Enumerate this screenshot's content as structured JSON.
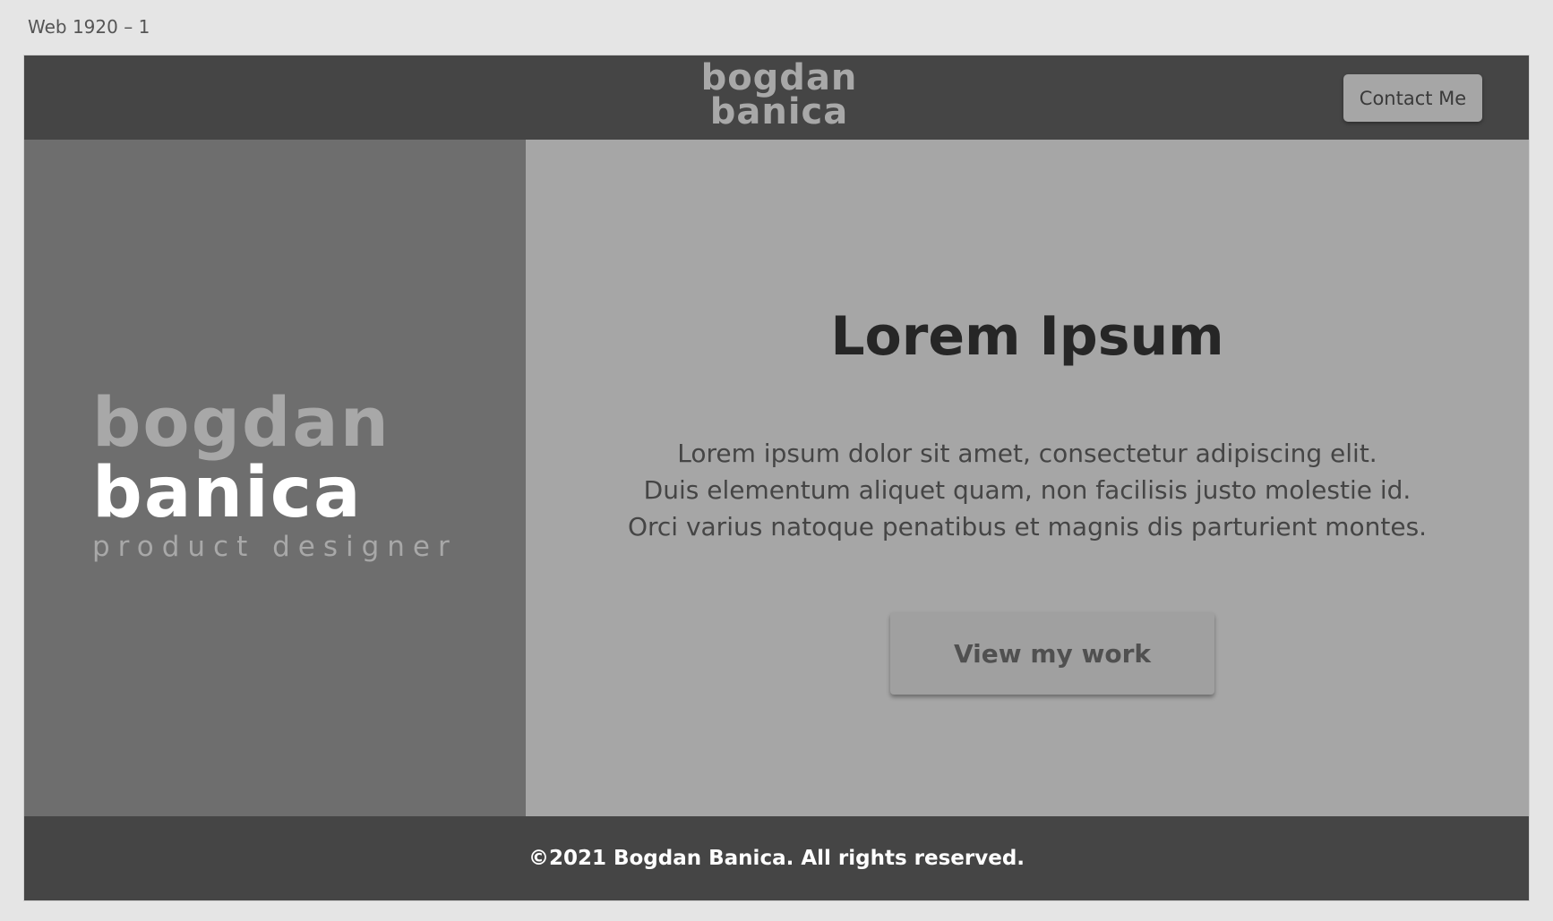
{
  "canvas": {
    "artboard_label": "Web 1920 – 1"
  },
  "header": {
    "logo_line1": "bogdan",
    "logo_line2": "banica",
    "contact_label": "Contact Me"
  },
  "sidebar": {
    "logo_line1": "bogdan",
    "logo_line2": "banica",
    "tagline": "product designer"
  },
  "hero": {
    "title": "Lorem Ipsum",
    "lines": [
      "Lorem ipsum dolor sit amet, consectetur adipiscing elit.",
      "Duis elementum aliquet quam, non facilisis justo molestie id.",
      "Orci varius natoque penatibus et magnis dis parturient montes."
    ],
    "cta_label": "View my work"
  },
  "footer": {
    "text": "©2021 Bogdan Banica. All rights reserved."
  },
  "colors": {
    "canvas_bg": "#e5e5e5",
    "header_bg": "#454545",
    "left_panel_bg": "#6e6e6e",
    "right_panel_bg": "#a6a6a6",
    "title_text": "#262626",
    "logo_gray": "#a8a8a8",
    "logo_white": "#ffffff"
  }
}
